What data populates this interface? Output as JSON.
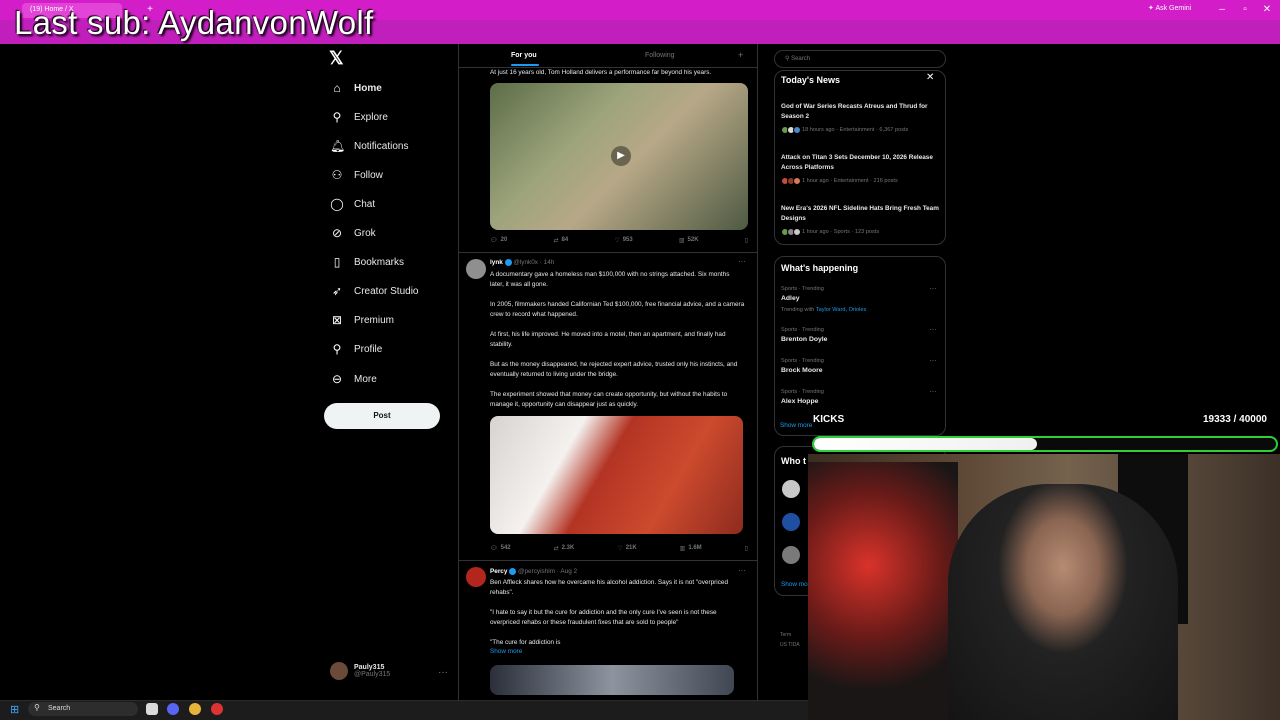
{
  "browser": {
    "tabs": [
      "(19) Home / X"
    ],
    "ask_gemini": "Ask Gemini"
  },
  "overlay": {
    "last_sub": "Last sub: AydanvonWolf",
    "kicks_label": "KICKS",
    "kicks_count": "19333 / 40000",
    "kicks_progress": 0.483
  },
  "nav": {
    "items": [
      {
        "label": "Home",
        "icon": "house-icon"
      },
      {
        "label": "Explore",
        "icon": "search-icon"
      },
      {
        "label": "Notifications",
        "icon": "bell-icon"
      },
      {
        "label": "Follow",
        "icon": "person-add-icon"
      },
      {
        "label": "Chat",
        "icon": "chat-icon"
      },
      {
        "label": "Grok",
        "icon": "grok-icon"
      },
      {
        "label": "Bookmarks",
        "icon": "bookmark-icon"
      },
      {
        "label": "Creator Studio",
        "icon": "rocket-icon"
      },
      {
        "label": "Premium",
        "icon": "x-premium-icon"
      },
      {
        "label": "Profile",
        "icon": "person-icon"
      },
      {
        "label": "More",
        "icon": "more-circle-icon"
      }
    ],
    "post_label": "Post",
    "account_name": "Pauly315",
    "account_handle": "@Pauly315"
  },
  "feed": {
    "tab_for_you": "For you",
    "tab_following": "Following",
    "post1": {
      "text": "At just 16 years old, Tom Holland delivers a performance far beyond his years.",
      "replies": "20",
      "reposts": "84",
      "likes": "953",
      "views": "52K"
    },
    "post2": {
      "name": "lynk",
      "handle": "@lynk0x",
      "time": "14h",
      "p1": "A documentary gave a homeless man $100,000 with no strings attached. Six months later, it was all gone.",
      "p2": "In 2005, filmmakers handed Californian Ted $100,000, free financial advice, and a camera crew to record what happened.",
      "p3": "At first, his life improved. He moved into a motel, then an apartment, and finally had stability.",
      "p4": "But as the money disappeared, he rejected expert advice, trusted only his instincts, and eventually returned to living under the bridge.",
      "p5": "The experiment showed that money can create opportunity, but without the habits to manage it, opportunity can disappear just as quickly.",
      "replies": "542",
      "reposts": "2.3K",
      "likes": "21K",
      "views": "1.6M"
    },
    "post3": {
      "name": "Percy",
      "handle": "@percyishim",
      "time": "Aug 2",
      "p1": "Ben Affleck shares how he overcame his alcohol addiction. Says it is not \"overpriced rehabs\".",
      "p2": "\"I hate to say it but the cure for addiction and the only cure I've seen is not these overpriced rehabs or these fraudulent fixes that are sold to people\"",
      "p3": "\"The cure for addiction is",
      "show_more": "Show more"
    }
  },
  "right": {
    "search_placeholder": "Search",
    "news_title": "Today's News",
    "news": [
      {
        "title": "God of War Series Recasts Atreus and Thrud for Season 2",
        "meta": "18 hours ago · Entertainment · 6,367 posts"
      },
      {
        "title": "Attack on Titan 3 Sets December 10, 2026 Release Across Platforms",
        "meta": "1 hour ago · Entertainment · 216 posts"
      },
      {
        "title": "New Era's 2026 NFL Sideline Hats Bring Fresh Team Designs",
        "meta": "1 hour ago · Sports · 123 posts"
      }
    ],
    "happening_title": "What's happening",
    "trends": [
      {
        "cat": "Sports · Trending",
        "name": "Adley",
        "sub_prefix": "Trending with ",
        "sub_links": "Taylor Ward, Orioles"
      },
      {
        "cat": "Sports · Trending",
        "name": "Brenton Doyle"
      },
      {
        "cat": "Sports · Trending",
        "name": "Brock Moore"
      },
      {
        "cat": "Sports · Trending",
        "name": "Alex Hoppe"
      }
    ],
    "happening_show_more": "Show more",
    "who_title": "Who t",
    "who_show_more": "Show mo",
    "footer_1": "Term",
    "footer_2": "US TIDA"
  },
  "taskbar": {
    "search": "Search"
  }
}
